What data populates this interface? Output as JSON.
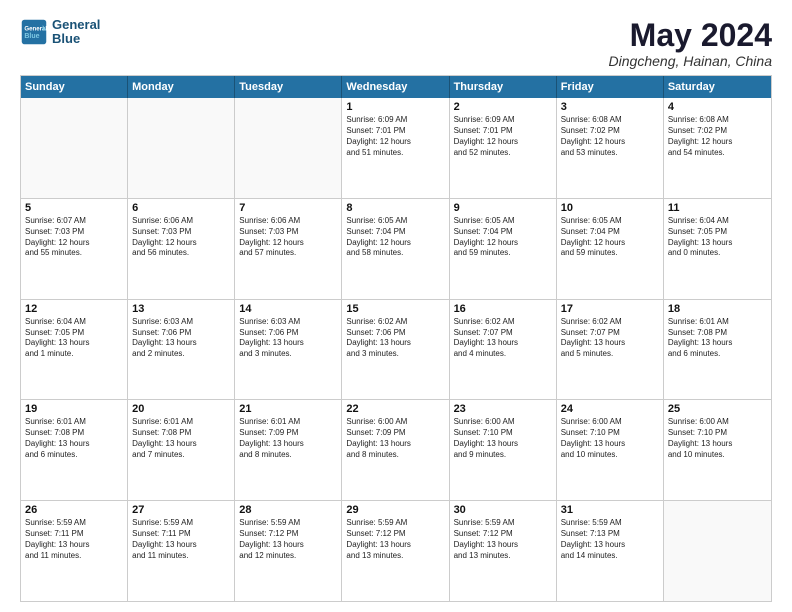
{
  "logo": {
    "line1": "General",
    "line2": "Blue"
  },
  "title": "May 2024",
  "location": "Dingcheng, Hainan, China",
  "header_days": [
    "Sunday",
    "Monday",
    "Tuesday",
    "Wednesday",
    "Thursday",
    "Friday",
    "Saturday"
  ],
  "weeks": [
    [
      {
        "day": "",
        "text": "",
        "empty": true
      },
      {
        "day": "",
        "text": "",
        "empty": true
      },
      {
        "day": "",
        "text": "",
        "empty": true
      },
      {
        "day": "1",
        "text": "Sunrise: 6:09 AM\nSunset: 7:01 PM\nDaylight: 12 hours\nand 51 minutes."
      },
      {
        "day": "2",
        "text": "Sunrise: 6:09 AM\nSunset: 7:01 PM\nDaylight: 12 hours\nand 52 minutes."
      },
      {
        "day": "3",
        "text": "Sunrise: 6:08 AM\nSunset: 7:02 PM\nDaylight: 12 hours\nand 53 minutes."
      },
      {
        "day": "4",
        "text": "Sunrise: 6:08 AM\nSunset: 7:02 PM\nDaylight: 12 hours\nand 54 minutes."
      }
    ],
    [
      {
        "day": "5",
        "text": "Sunrise: 6:07 AM\nSunset: 7:03 PM\nDaylight: 12 hours\nand 55 minutes."
      },
      {
        "day": "6",
        "text": "Sunrise: 6:06 AM\nSunset: 7:03 PM\nDaylight: 12 hours\nand 56 minutes."
      },
      {
        "day": "7",
        "text": "Sunrise: 6:06 AM\nSunset: 7:03 PM\nDaylight: 12 hours\nand 57 minutes."
      },
      {
        "day": "8",
        "text": "Sunrise: 6:05 AM\nSunset: 7:04 PM\nDaylight: 12 hours\nand 58 minutes."
      },
      {
        "day": "9",
        "text": "Sunrise: 6:05 AM\nSunset: 7:04 PM\nDaylight: 12 hours\nand 59 minutes."
      },
      {
        "day": "10",
        "text": "Sunrise: 6:05 AM\nSunset: 7:04 PM\nDaylight: 12 hours\nand 59 minutes."
      },
      {
        "day": "11",
        "text": "Sunrise: 6:04 AM\nSunset: 7:05 PM\nDaylight: 13 hours\nand 0 minutes."
      }
    ],
    [
      {
        "day": "12",
        "text": "Sunrise: 6:04 AM\nSunset: 7:05 PM\nDaylight: 13 hours\nand 1 minute."
      },
      {
        "day": "13",
        "text": "Sunrise: 6:03 AM\nSunset: 7:06 PM\nDaylight: 13 hours\nand 2 minutes."
      },
      {
        "day": "14",
        "text": "Sunrise: 6:03 AM\nSunset: 7:06 PM\nDaylight: 13 hours\nand 3 minutes."
      },
      {
        "day": "15",
        "text": "Sunrise: 6:02 AM\nSunset: 7:06 PM\nDaylight: 13 hours\nand 3 minutes."
      },
      {
        "day": "16",
        "text": "Sunrise: 6:02 AM\nSunset: 7:07 PM\nDaylight: 13 hours\nand 4 minutes."
      },
      {
        "day": "17",
        "text": "Sunrise: 6:02 AM\nSunset: 7:07 PM\nDaylight: 13 hours\nand 5 minutes."
      },
      {
        "day": "18",
        "text": "Sunrise: 6:01 AM\nSunset: 7:08 PM\nDaylight: 13 hours\nand 6 minutes."
      }
    ],
    [
      {
        "day": "19",
        "text": "Sunrise: 6:01 AM\nSunset: 7:08 PM\nDaylight: 13 hours\nand 6 minutes."
      },
      {
        "day": "20",
        "text": "Sunrise: 6:01 AM\nSunset: 7:08 PM\nDaylight: 13 hours\nand 7 minutes."
      },
      {
        "day": "21",
        "text": "Sunrise: 6:01 AM\nSunset: 7:09 PM\nDaylight: 13 hours\nand 8 minutes."
      },
      {
        "day": "22",
        "text": "Sunrise: 6:00 AM\nSunset: 7:09 PM\nDaylight: 13 hours\nand 8 minutes."
      },
      {
        "day": "23",
        "text": "Sunrise: 6:00 AM\nSunset: 7:10 PM\nDaylight: 13 hours\nand 9 minutes."
      },
      {
        "day": "24",
        "text": "Sunrise: 6:00 AM\nSunset: 7:10 PM\nDaylight: 13 hours\nand 10 minutes."
      },
      {
        "day": "25",
        "text": "Sunrise: 6:00 AM\nSunset: 7:10 PM\nDaylight: 13 hours\nand 10 minutes."
      }
    ],
    [
      {
        "day": "26",
        "text": "Sunrise: 5:59 AM\nSunset: 7:11 PM\nDaylight: 13 hours\nand 11 minutes."
      },
      {
        "day": "27",
        "text": "Sunrise: 5:59 AM\nSunset: 7:11 PM\nDaylight: 13 hours\nand 11 minutes."
      },
      {
        "day": "28",
        "text": "Sunrise: 5:59 AM\nSunset: 7:12 PM\nDaylight: 13 hours\nand 12 minutes."
      },
      {
        "day": "29",
        "text": "Sunrise: 5:59 AM\nSunset: 7:12 PM\nDaylight: 13 hours\nand 13 minutes."
      },
      {
        "day": "30",
        "text": "Sunrise: 5:59 AM\nSunset: 7:12 PM\nDaylight: 13 hours\nand 13 minutes."
      },
      {
        "day": "31",
        "text": "Sunrise: 5:59 AM\nSunset: 7:13 PM\nDaylight: 13 hours\nand 14 minutes."
      },
      {
        "day": "",
        "text": "",
        "empty": true
      }
    ]
  ]
}
